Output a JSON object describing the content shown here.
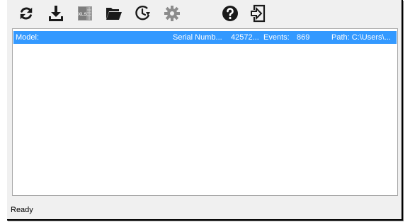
{
  "toolbar": {
    "buttons": [
      {
        "icon": "refresh-icon"
      },
      {
        "icon": "download-icon"
      },
      {
        "icon": "excel-export-icon",
        "badge": "XLS"
      },
      {
        "icon": "open-folder-icon"
      },
      {
        "icon": "history-clock-icon"
      },
      {
        "icon": "settings-gear-icon"
      },
      {
        "icon": "help-icon"
      },
      {
        "icon": "exit-icon"
      }
    ]
  },
  "devices": [
    {
      "model_label": "Model:",
      "model_value": "",
      "serial_label": "Serial Numb...",
      "serial_value": "42572...",
      "events_label": "Events:",
      "events_value": "869",
      "path": "Path: C:\\Users\\..."
    }
  ],
  "status": {
    "text": "Ready"
  },
  "colors": {
    "selection": "#3399ff",
    "icon": "#1a1a1a",
    "gear": "#8c8c8c"
  }
}
